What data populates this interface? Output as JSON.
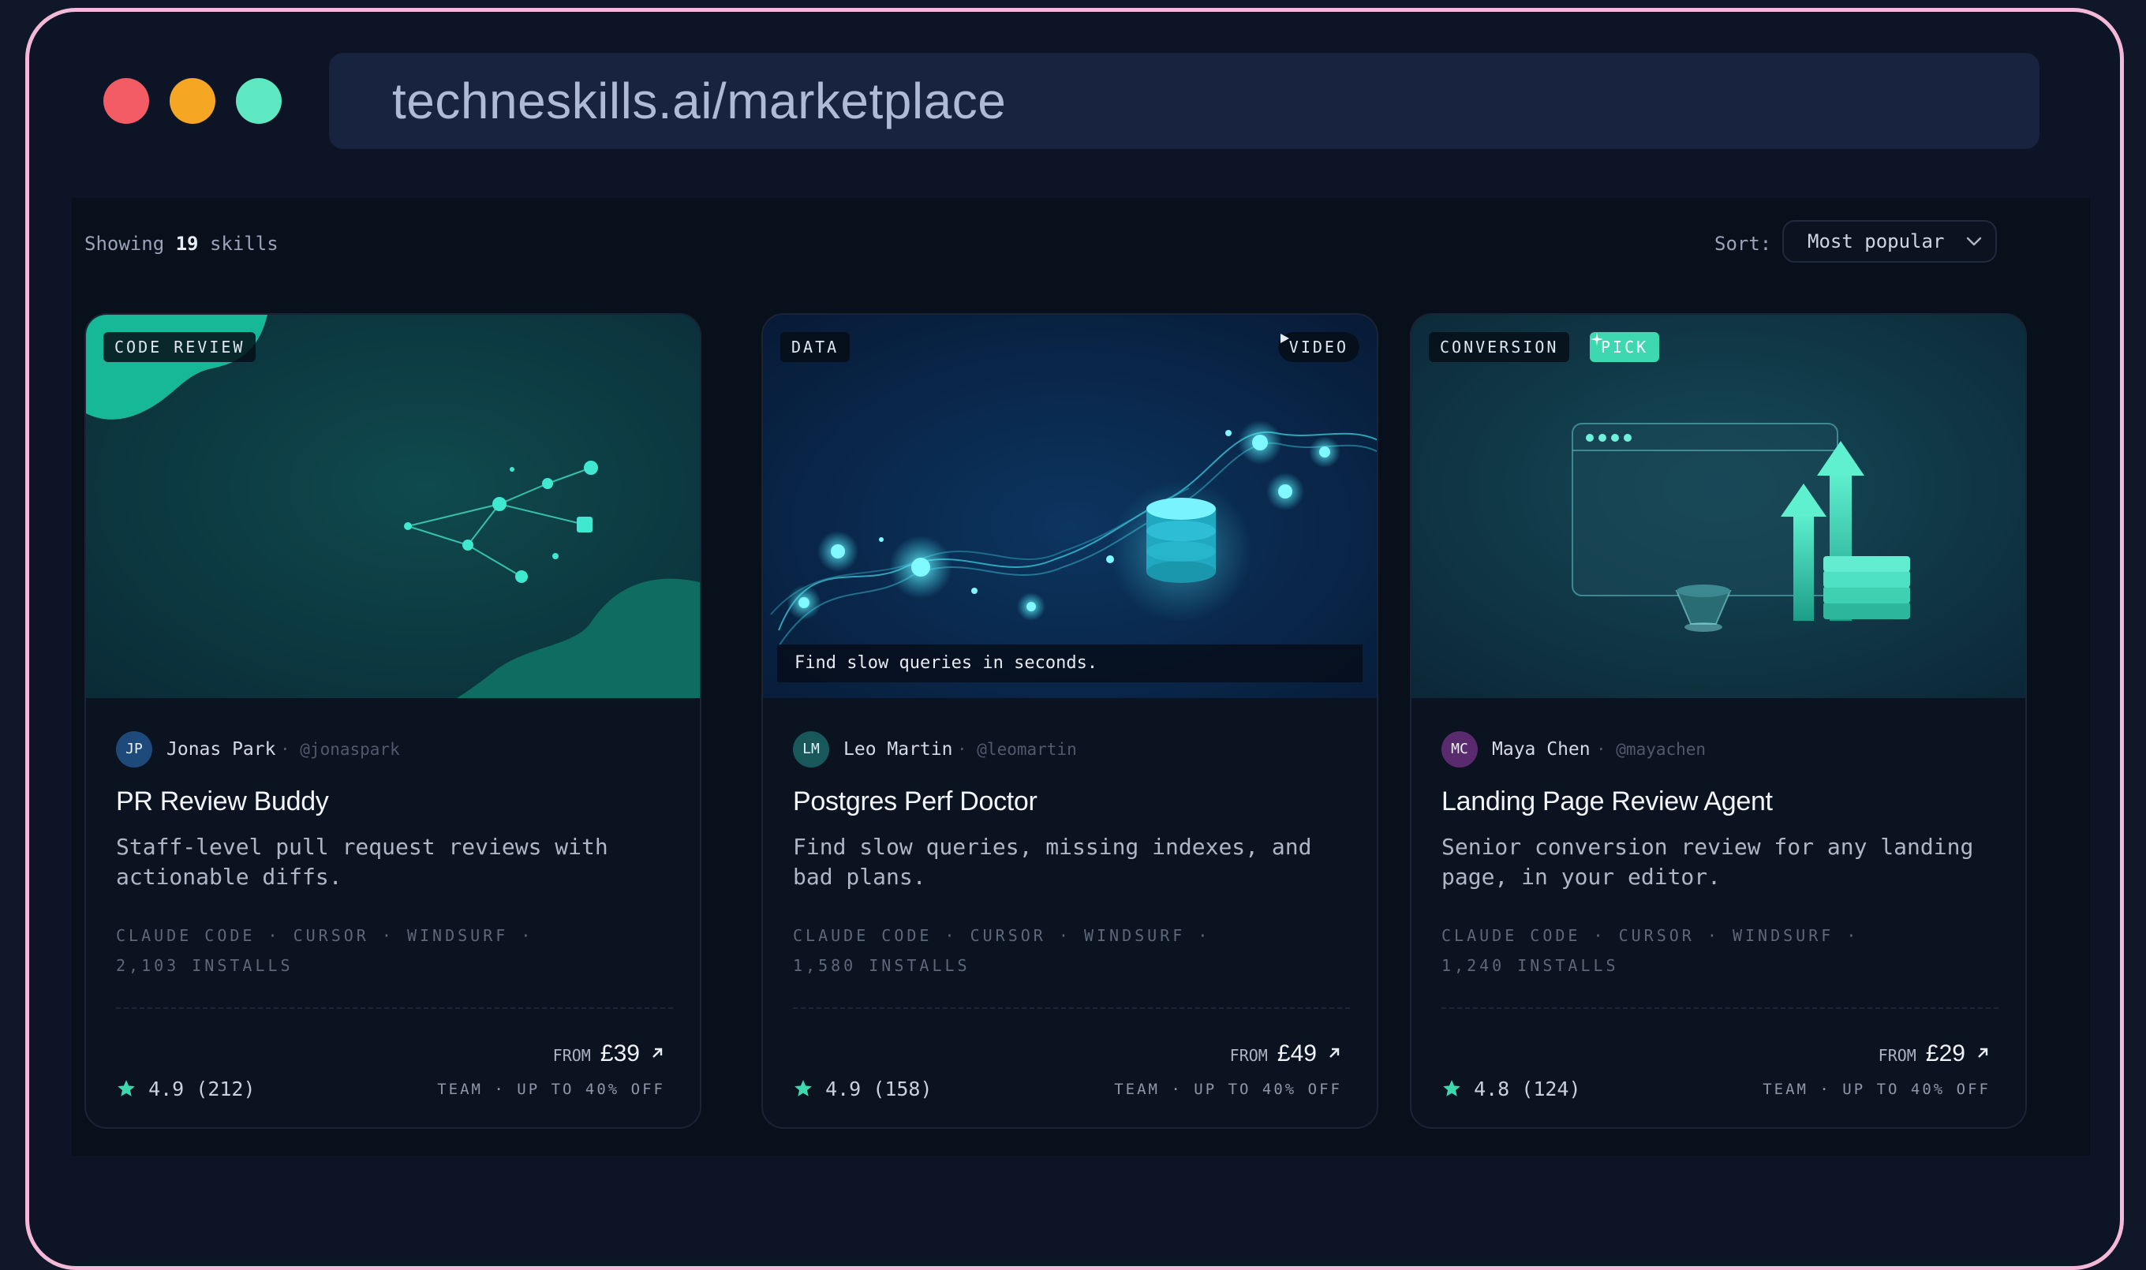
{
  "browser": {
    "url": "techneskills.ai/marketplace"
  },
  "toolbar": {
    "showing_prefix": "Showing",
    "count": "19",
    "showing_suffix": "skills",
    "sort_label": "Sort:",
    "sort_value": "Most popular"
  },
  "cards": [
    {
      "badge": "CODE REVIEW",
      "author_initials": "JP",
      "author_name": "Jonas Park",
      "author_handle": "· @jonaspark",
      "title": "PR Review Buddy",
      "description": "Staff-level pull request reviews with actionable diffs.",
      "platforms": "CLAUDE CODE · CURSOR · WINDSURF ·",
      "installs": "2,103 INSTALLS",
      "from_label": "FROM",
      "price": "£39",
      "rating": "4.9 (212)",
      "team": "TEAM · UP TO 40% OFF",
      "avatar_color": "#1d4a7a"
    },
    {
      "badge": "DATA",
      "video_badge": "VIDEO",
      "caption": "Find slow queries in seconds.",
      "author_initials": "LM",
      "author_name": "Leo Martin",
      "author_handle": "· @leomartin",
      "title": "Postgres Perf Doctor",
      "description": "Find slow queries, missing indexes, and bad plans.",
      "platforms": "CLAUDE CODE · CURSOR · WINDSURF ·",
      "installs": "1,580 INSTALLS",
      "from_label": "FROM",
      "price": "£49",
      "rating": "4.9 (158)",
      "team": "TEAM · UP TO 40% OFF",
      "avatar_color": "#18585a"
    },
    {
      "badge": "CONVERSION",
      "pick_badge": "PICK",
      "author_initials": "MC",
      "author_name": "Maya Chen",
      "author_handle": "· @mayachen",
      "title": "Landing Page Review Agent",
      "description": "Senior conversion review for any landing page, in your editor.",
      "platforms": "CLAUDE CODE · CURSOR · WINDSURF ·",
      "installs": "1,240 INSTALLS",
      "from_label": "FROM",
      "price": "£29",
      "rating": "4.8 (124)",
      "team": "TEAM · UP TO 40% OFF",
      "avatar_color": "#5a2a6e"
    }
  ],
  "colors": {
    "accent": "#3ed8b0",
    "star": "#3ed8b0",
    "traffic_red": "#f35c65",
    "traffic_yellow": "#f5a623",
    "traffic_green": "#5ee8c2",
    "frame_border": "#f4b8d8"
  },
  "icons": [
    "chevron-down-icon",
    "star-icon",
    "arrow-up-right-icon",
    "play-icon",
    "sparkle-icon"
  ]
}
